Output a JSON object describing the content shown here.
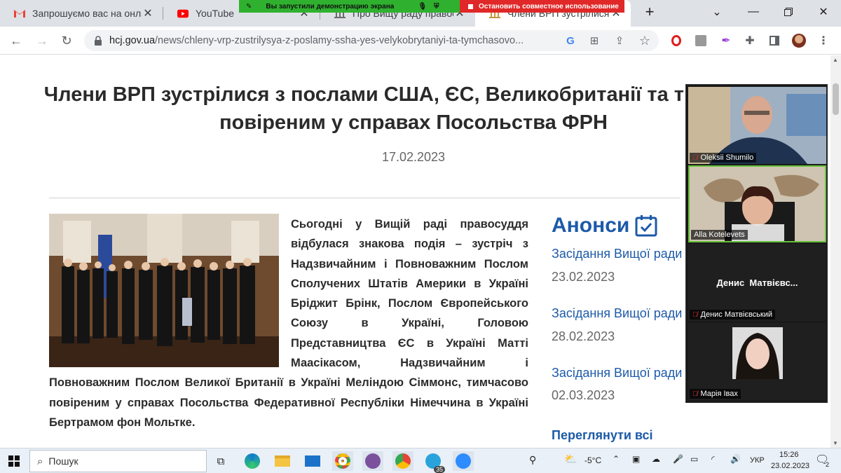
{
  "browser": {
    "tabs": [
      {
        "label": "Запрошуємо вас на онла"
      },
      {
        "label": "YouTube"
      },
      {
        "label": "Про Вищу раду правосуд"
      },
      {
        "label": "Члени ВРП зустрілися з"
      }
    ],
    "share_banner": {
      "text": "Вы запустили демонстрацию экрана",
      "stop": "Остановить совместное использование"
    },
    "url_domain": "hcj.gov.ua",
    "url_path": "/news/chleny-vrp-zustrilysya-z-poslamy-ssha-yes-velykobrytaniyi-ta-tymchasovo..."
  },
  "article": {
    "title": "Члени ВРП зустрілися з послами США, ЄС, Великобританії та тимчасово повіреним у справах Посольства ФРН",
    "date": "17.02.2023",
    "body": "Сьогодні у Вищій раді правосуддя відбулася знакова подія – зустріч з Надзвичайним і Повноважним Послом Сполучених Штатів Америки в Україні Бріджит Брінк, Послом Європейського Союзу в Україні, Головою Представництва ЄС в Україні Матті Маасікасом, Надзвичайним і Повноважним Послом Великої Британії в Україні Меліндою Сіммонс, тимчасово повіреним у справах Посольства Федеративної Республіки Німеччина в Україні Бертрамом фон Мольтке."
  },
  "sidebar": {
    "title": "Анонси",
    "items": [
      {
        "title": "Засідання Вищої ради",
        "date": "23.02.2023"
      },
      {
        "title": "Засідання Вищої ради",
        "date": "28.02.2023"
      },
      {
        "title": "Засідання Вищої ради",
        "date": "02.03.2023"
      }
    ],
    "view_all": "Переглянути всі"
  },
  "zoom": {
    "participants": [
      {
        "name": "Oleksii Shumilo"
      },
      {
        "name": "Alla Kotelevets"
      },
      {
        "name": "Денис Матвієвський",
        "display": "Денис  Матвієвс..."
      },
      {
        "name": "Марія Івах"
      }
    ]
  },
  "taskbar": {
    "search": "Пошук",
    "badge_telegram": "35",
    "temperature": "-5°C",
    "lang": "УКР",
    "time": "15:26",
    "date": "23.02.2023",
    "notifications": "2"
  }
}
